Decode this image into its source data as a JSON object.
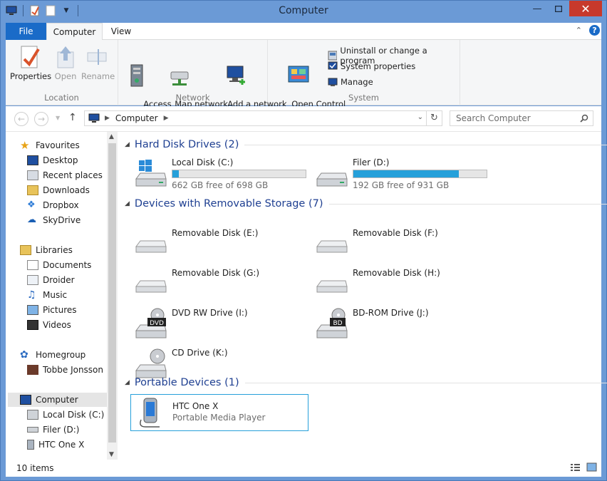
{
  "window": {
    "title": "Computer"
  },
  "tabs": [
    {
      "label": "File"
    },
    {
      "label": "Computer"
    },
    {
      "label": "View"
    }
  ],
  "ribbon": {
    "location": {
      "label": "Location",
      "buttons": [
        {
          "label": "Properties"
        },
        {
          "label": "Open"
        },
        {
          "label": "Rename"
        }
      ]
    },
    "network": {
      "label": "Network",
      "buttons": [
        {
          "label": "Access\nmedia ▾"
        },
        {
          "label": "Map network\ndrive ▾"
        },
        {
          "label": "Add a network\nlocation"
        }
      ]
    },
    "system": {
      "label": "System",
      "big": {
        "label": "Open Control\nPanel"
      },
      "small": [
        {
          "label": "Uninstall or change a program"
        },
        {
          "label": "System properties"
        },
        {
          "label": "Manage"
        }
      ]
    }
  },
  "address": {
    "path": "Computer",
    "search_placeholder": "Search Computer"
  },
  "sidebar": {
    "favourites": {
      "label": "Favourites",
      "items": [
        {
          "label": "Desktop"
        },
        {
          "label": "Recent places"
        },
        {
          "label": "Downloads"
        },
        {
          "label": "Dropbox"
        },
        {
          "label": "SkyDrive"
        }
      ]
    },
    "libraries": {
      "label": "Libraries",
      "items": [
        {
          "label": "Documents"
        },
        {
          "label": "Droider"
        },
        {
          "label": "Music"
        },
        {
          "label": "Pictures"
        },
        {
          "label": "Videos"
        }
      ]
    },
    "homegroup": {
      "label": "Homegroup",
      "items": [
        {
          "label": "Tobbe Jonsson"
        }
      ]
    },
    "computer": {
      "label": "Computer",
      "items": [
        {
          "label": "Local Disk (C:)"
        },
        {
          "label": "Filer (D:)"
        },
        {
          "label": "HTC One X"
        }
      ]
    }
  },
  "sections": {
    "hdd": {
      "title": "Hard Disk Drives (2)",
      "drives": [
        {
          "name": "Local Disk (C:)",
          "free": "662 GB free of 698 GB",
          "used_fraction": 0.05
        },
        {
          "name": "Filer (D:)",
          "free": "192 GB free of 931 GB",
          "used_fraction": 0.79
        }
      ]
    },
    "removable": {
      "title": "Devices with Removable Storage (7)",
      "items": [
        {
          "name": "Removable Disk (E:)"
        },
        {
          "name": "Removable Disk (F:)"
        },
        {
          "name": "Removable Disk (G:)"
        },
        {
          "name": "Removable Disk (H:)"
        },
        {
          "name": "DVD RW Drive (I:)",
          "badge": "DVD"
        },
        {
          "name": "BD-ROM Drive (J:)",
          "badge": "BD"
        },
        {
          "name": "CD Drive (K:)"
        }
      ]
    },
    "portable": {
      "title": "Portable Devices (1)",
      "items": [
        {
          "name": "HTC One X",
          "type": "Portable Media Player"
        }
      ]
    }
  },
  "status": {
    "text": "10 items"
  },
  "colors": {
    "titlebar": "#6b9ad6",
    "file_tab": "#1a6bc8",
    "close": "#c7392c",
    "accent": "#26a0da",
    "section_title": "#1e3f91"
  }
}
